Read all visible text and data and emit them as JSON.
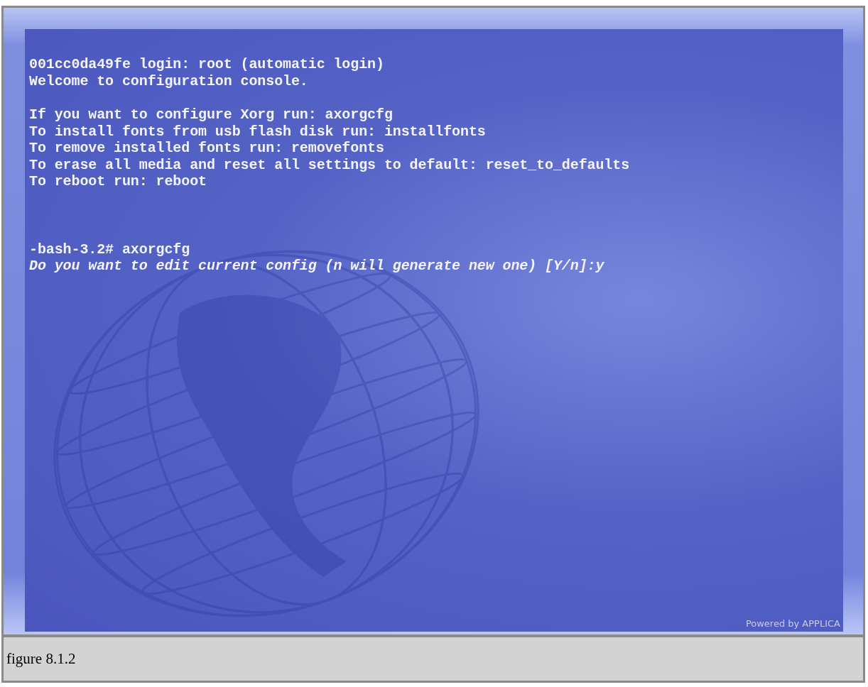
{
  "screen": {
    "blocks": [
      {
        "lines": [
          {
            "text": "001cc0da49fe login: root (automatic login)",
            "kind": "output"
          },
          {
            "text": "Welcome to configuration console.",
            "kind": "output"
          }
        ]
      },
      {
        "lines": [
          {
            "text": "If you want to configure Xorg run: axorgcfg",
            "kind": "output"
          },
          {
            "text": "To install fonts from usb flash disk run: installfonts",
            "kind": "output"
          },
          {
            "text": "To remove installed fonts run: removefonts",
            "kind": "output"
          },
          {
            "text": "To erase all media and reset all settings to default: reset_to_defaults",
            "kind": "output"
          },
          {
            "text": "To reboot run: reboot",
            "kind": "output"
          }
        ]
      },
      {
        "lines": [
          {
            "text": "-bash-3.2# axorgcfg",
            "kind": "output"
          },
          {
            "text": "Do you want to edit current config (n will generate new one) [Y/n]:y",
            "kind": "question"
          }
        ]
      }
    ],
    "branding": "Powered by APPLICA"
  },
  "caption": "figure 8.1.2"
}
